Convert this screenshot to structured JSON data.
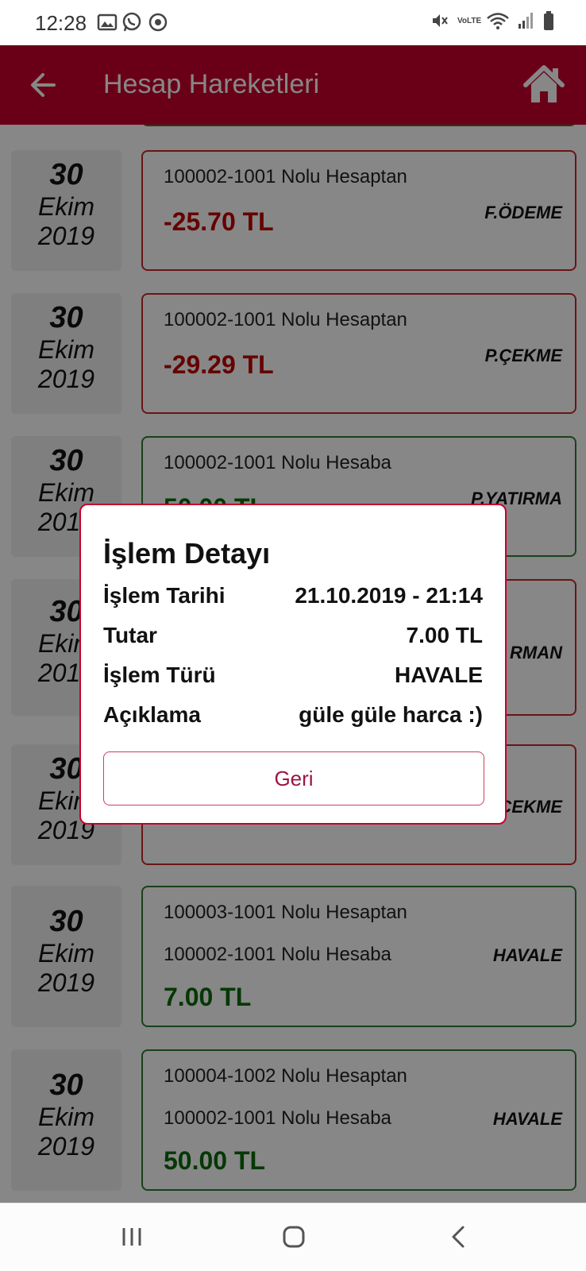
{
  "status_bar": {
    "time": "12:28",
    "network_label": "VoLTE"
  },
  "app_bar": {
    "title": "Hesap Hareketleri",
    "back_icon": "arrow-left-icon",
    "home_icon": "home-icon",
    "color": "#c8002d"
  },
  "transactions": [
    {
      "day": "30",
      "month": "Ekim",
      "year": "2019",
      "lines": [
        "100002-1001 Nolu Hesaptan"
      ],
      "amount": "-25.70 TL",
      "type": "F.ÖDEME",
      "status": "negative"
    },
    {
      "day": "30",
      "month": "Ekim",
      "year": "2019",
      "lines": [
        "100002-1001 Nolu Hesaptan"
      ],
      "amount": "-29.29 TL",
      "type": "P.ÇEKME",
      "status": "negative"
    },
    {
      "day": "30",
      "month": "Ekim",
      "year": "2019",
      "lines": [
        "100002-1001 Nolu Hesaba"
      ],
      "amount": "50.00 TL",
      "type": "P.YATIRMA",
      "status": "positive"
    },
    {
      "day": "30",
      "month": "Ekim",
      "year": "2019",
      "lines": [],
      "amount": "",
      "type": "RMAN",
      "status": "negative"
    },
    {
      "day": "30",
      "month": "Ekim",
      "year": "2019",
      "lines": [],
      "amount": "",
      "type": "ÇEKME",
      "status": "negative"
    },
    {
      "day": "30",
      "month": "Ekim",
      "year": "2019",
      "lines": [
        "100003-1001 Nolu Hesaptan",
        "100002-1001 Nolu Hesaba"
      ],
      "amount": "7.00 TL",
      "type": "HAVALE",
      "status": "positive"
    },
    {
      "day": "30",
      "month": "Ekim",
      "year": "2019",
      "lines": [
        "100004-1002 Nolu Hesaptan",
        "100002-1001 Nolu Hesaba"
      ],
      "amount": "50.00 TL",
      "type": "HAVALE",
      "status": "positive"
    }
  ],
  "dialog": {
    "title": "İşlem Detayı",
    "rows": [
      {
        "label": "İşlem Tarihi",
        "value": "21.10.2019 - 21:14"
      },
      {
        "label": "Tutar",
        "value": "7.00 TL"
      },
      {
        "label": "İşlem Türü",
        "value": "HAVALE"
      },
      {
        "label": "Açıklama",
        "value": "güle güle harca :)"
      }
    ],
    "back_button": "Geri"
  },
  "nav_bar": {
    "recents_icon": "recents-icon",
    "home_icon": "home-circle-icon",
    "back_icon": "chevron-left-icon"
  },
  "colors": {
    "negative": "#c00000",
    "positive": "#0a6a0a",
    "accent": "#c8002d"
  }
}
